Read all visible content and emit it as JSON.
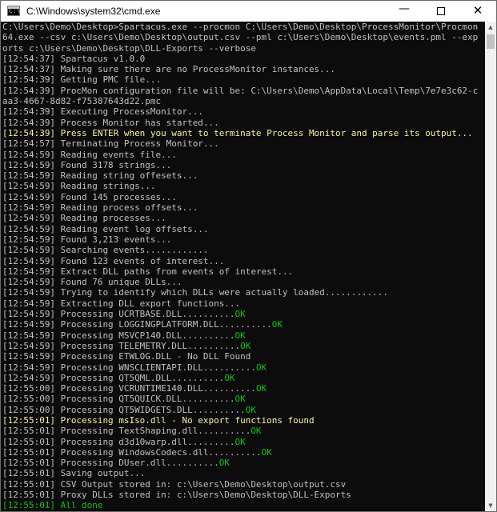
{
  "window": {
    "title": "C:\\Windows\\system32\\cmd.exe",
    "icon": "cmd-icon",
    "icon_glyph": "C:\\",
    "controls": {
      "minimize": "—",
      "maximize": "maximize-icon",
      "close": "✕"
    }
  },
  "colors": {
    "background": "#0c0c0c",
    "text": "#c0c0c0",
    "ok": "#13c313",
    "highlight": "#f9f1a5"
  },
  "console": {
    "lines": [
      {
        "segments": [
          {
            "text": "C:\\Users\\Demo\\Desktop>Spartacus.exe --procmon C:\\Users\\Demo\\Desktop\\ProcessMonitor\\Procmon",
            "style": "normal"
          }
        ]
      },
      {
        "segments": [
          {
            "text": "64.exe --csv c:\\Users\\Demo\\Desktop\\output.csv --pml c:\\Users\\Demo\\Desktop\\events.pml --exp",
            "style": "normal"
          }
        ]
      },
      {
        "segments": [
          {
            "text": "orts c:\\Users\\Demo\\Desktop\\DLL-Exports --verbose",
            "style": "normal"
          }
        ]
      },
      {
        "segments": [
          {
            "text": "[12:54:37] Spartacus v1.0.0",
            "style": "normal"
          }
        ]
      },
      {
        "segments": [
          {
            "text": "[12:54:37] Making sure there are no ProcessMonitor instances...",
            "style": "normal"
          }
        ]
      },
      {
        "segments": [
          {
            "text": "[12:54:39] Getting PMC file...",
            "style": "normal"
          }
        ]
      },
      {
        "segments": [
          {
            "text": "[12:54:39] ProcMon configuration file will be: C:\\Users\\Demo\\AppData\\Local\\Temp\\7e7e3c62-c",
            "style": "normal"
          }
        ]
      },
      {
        "segments": [
          {
            "text": "aa3-4667-8d82-f75387643d22.pmc",
            "style": "normal"
          }
        ]
      },
      {
        "segments": [
          {
            "text": "[12:54:39] Executing ProcessMonitor...",
            "style": "normal"
          }
        ]
      },
      {
        "segments": [
          {
            "text": "[12:54:39] Process Monitor has started...",
            "style": "normal"
          }
        ]
      },
      {
        "style": "warn",
        "segments": [
          {
            "text": "[12:54:39] Press ENTER when you want to terminate Process Monitor and parse its output...",
            "style": "normal"
          }
        ]
      },
      {
        "segments": [
          {
            "text": "[12:54:57] Terminating Process Monitor...",
            "style": "normal"
          }
        ]
      },
      {
        "segments": [
          {
            "text": "[12:54:59] Reading events file...",
            "style": "normal"
          }
        ]
      },
      {
        "segments": [
          {
            "text": "[12:54:59] Found 3178 strings...",
            "style": "normal"
          }
        ]
      },
      {
        "segments": [
          {
            "text": "[12:54:59] Reading string offesets...",
            "style": "normal"
          }
        ]
      },
      {
        "segments": [
          {
            "text": "[12:54:59] Reading strings...",
            "style": "normal"
          }
        ]
      },
      {
        "segments": [
          {
            "text": "[12:54:59] Found 145 processes...",
            "style": "normal"
          }
        ]
      },
      {
        "segments": [
          {
            "text": "[12:54:59] Reading process offsets...",
            "style": "normal"
          }
        ]
      },
      {
        "segments": [
          {
            "text": "[12:54:59] Reading processes...",
            "style": "normal"
          }
        ]
      },
      {
        "segments": [
          {
            "text": "[12:54:59] Reading event log offsets...",
            "style": "normal"
          }
        ]
      },
      {
        "segments": [
          {
            "text": "[12:54:59] Found 3,213 events...",
            "style": "normal"
          }
        ]
      },
      {
        "segments": [
          {
            "text": "[12:54:59] Searching events............",
            "style": "normal"
          }
        ]
      },
      {
        "segments": [
          {
            "text": "[12:54:59] Found 123 events of interest...",
            "style": "normal"
          }
        ]
      },
      {
        "segments": [
          {
            "text": "[12:54:59] Extract DLL paths from events of interest...",
            "style": "normal"
          }
        ]
      },
      {
        "segments": [
          {
            "text": "[12:54:59] Found 76 unique DLLs...",
            "style": "normal"
          }
        ]
      },
      {
        "segments": [
          {
            "text": "[12:54:59] Trying to identify which DLLs were actually loaded............",
            "style": "normal"
          }
        ]
      },
      {
        "segments": [
          {
            "text": "[12:54:59] Extracting DLL export functions...",
            "style": "normal"
          }
        ]
      },
      {
        "segments": [
          {
            "text": "[12:54:59] Processing UCRTBASE.DLL..........",
            "style": "normal"
          },
          {
            "text": "OK",
            "style": "ok"
          }
        ]
      },
      {
        "segments": [
          {
            "text": "[12:54:59] Processing LOGGINGPLATFORM.DLL..........",
            "style": "normal"
          },
          {
            "text": "OK",
            "style": "ok"
          }
        ]
      },
      {
        "segments": [
          {
            "text": "[12:54:59] Processing MSVCP140.DLL..........",
            "style": "normal"
          },
          {
            "text": "OK",
            "style": "ok"
          }
        ]
      },
      {
        "segments": [
          {
            "text": "[12:54:59] Processing TELEMETRY.DLL..........",
            "style": "normal"
          },
          {
            "text": "OK",
            "style": "ok"
          }
        ]
      },
      {
        "segments": [
          {
            "text": "[12:54:59] Processing ETWLOG.DLL - No DLL Found",
            "style": "normal"
          }
        ]
      },
      {
        "segments": [
          {
            "text": "[12:54:59] Processing WNSCLIENTAPI.DLL..........",
            "style": "normal"
          },
          {
            "text": "OK",
            "style": "ok"
          }
        ]
      },
      {
        "segments": [
          {
            "text": "[12:54:59] Processing QT5QML.DLL..........",
            "style": "normal"
          },
          {
            "text": "OK",
            "style": "ok"
          }
        ]
      },
      {
        "segments": [
          {
            "text": "[12:55:00] Processing VCRUNTIME140.DLL..........",
            "style": "normal"
          },
          {
            "text": "OK",
            "style": "ok"
          }
        ]
      },
      {
        "segments": [
          {
            "text": "[12:55:00] Processing QT5QUICK.DLL..........",
            "style": "normal"
          },
          {
            "text": "OK",
            "style": "ok"
          }
        ]
      },
      {
        "segments": [
          {
            "text": "[12:55:00] Processing QT5WIDGETS.DLL..........",
            "style": "normal"
          },
          {
            "text": "OK",
            "style": "ok"
          }
        ]
      },
      {
        "segments": [
          {
            "text": "[12:55:01] Processing msIso.dll - No export functions found",
            "style": "warn"
          }
        ]
      },
      {
        "segments": [
          {
            "text": "[12:55:01] Processing TextShaping.dll..........",
            "style": "normal"
          },
          {
            "text": "OK",
            "style": "ok"
          }
        ]
      },
      {
        "segments": [
          {
            "text": "[12:55:01] Processing d3d10warp.dll.........",
            "style": "normal"
          },
          {
            "text": "OK",
            "style": "ok"
          }
        ]
      },
      {
        "segments": [
          {
            "text": "[12:55:01] Processing WindowsCodecs.dll..........",
            "style": "normal"
          },
          {
            "text": "OK",
            "style": "ok"
          }
        ]
      },
      {
        "segments": [
          {
            "text": "[12:55:01] Processing DUser.dll..........",
            "style": "normal"
          },
          {
            "text": "OK",
            "style": "ok"
          }
        ]
      },
      {
        "segments": [
          {
            "text": "[12:55:01] Saving output...",
            "style": "normal"
          }
        ]
      },
      {
        "segments": [
          {
            "text": "[12:55:01] CSV Output stored in: c:\\Users\\Demo\\Desktop\\output.csv",
            "style": "normal"
          }
        ]
      },
      {
        "segments": [
          {
            "text": "[12:55:01] Proxy DLLs stored in: c:\\Users\\Demo\\Desktop\\DLL-Exports",
            "style": "normal"
          }
        ]
      },
      {
        "style": "done",
        "segments": [
          {
            "text": "[12:55:01] All done",
            "style": "normal"
          }
        ]
      }
    ]
  }
}
